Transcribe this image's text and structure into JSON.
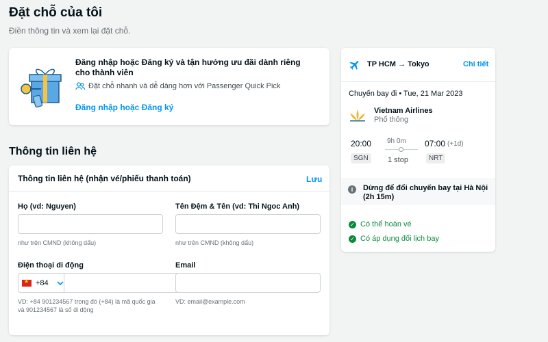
{
  "page": {
    "title": "Đặt chỗ của tôi",
    "subtitle": "Điền thông tin và xem lại đặt chỗ."
  },
  "login": {
    "heading": "Đăng nhập hoặc Đăng ký và tận hưởng ưu đãi dành riêng cho thành viên",
    "quick_pick": "Đặt chỗ nhanh và dễ dàng hơn với Passenger Quick Pick",
    "link": "Đăng nhập hoặc Đăng ký"
  },
  "contact": {
    "section_title": "Thông tin liên hệ",
    "card_title": "Thông tin liên hệ (nhận vé/phiếu thanh toán)",
    "save": "Lưu",
    "last_name_label": "Họ (vd: Nguyen)",
    "last_name_value": "",
    "last_name_hint": "như trên CMND (không dấu)",
    "first_name_label": "Tên Đệm & Tên (vd: Thi Ngoc Anh)",
    "first_name_value": "",
    "first_name_hint": "như trên CMND (không dấu)",
    "phone_label": "Điện thoại di động",
    "phone_code": "+84",
    "phone_value": "",
    "phone_hint_1": "VD: +84 901234567 trong đó (+84) là mã quốc gia",
    "phone_hint_2": "và 901234567 là số di động",
    "email_label": "Email",
    "email_value": "",
    "email_hint": "VD: email@example.com"
  },
  "flight": {
    "route": "TP HCM → Tokyo",
    "detail_link": "Chi tiết",
    "date": "Chuyến bay đi • Tue, 21 Mar 2023",
    "airline": "Vietnam Airlines",
    "cabin": "Phổ thông",
    "depart_time": "20:00",
    "depart_code": "SGN",
    "duration": "9h 0m",
    "stops": "1 stop",
    "arrive_time": "07:00",
    "arrive_offset": "(+1d)",
    "arrive_code": "NRT",
    "stopover": "Dừng để đổi chuyến bay tại Hà Nội (2h 15m)",
    "benefit_refund": "Có thể hoàn vé",
    "benefit_reschedule": "Có áp dụng đổi lịch bay"
  },
  "colors": {
    "accent": "#0194f3",
    "success": "#0b8a3e",
    "background": "#f2f3f3"
  }
}
